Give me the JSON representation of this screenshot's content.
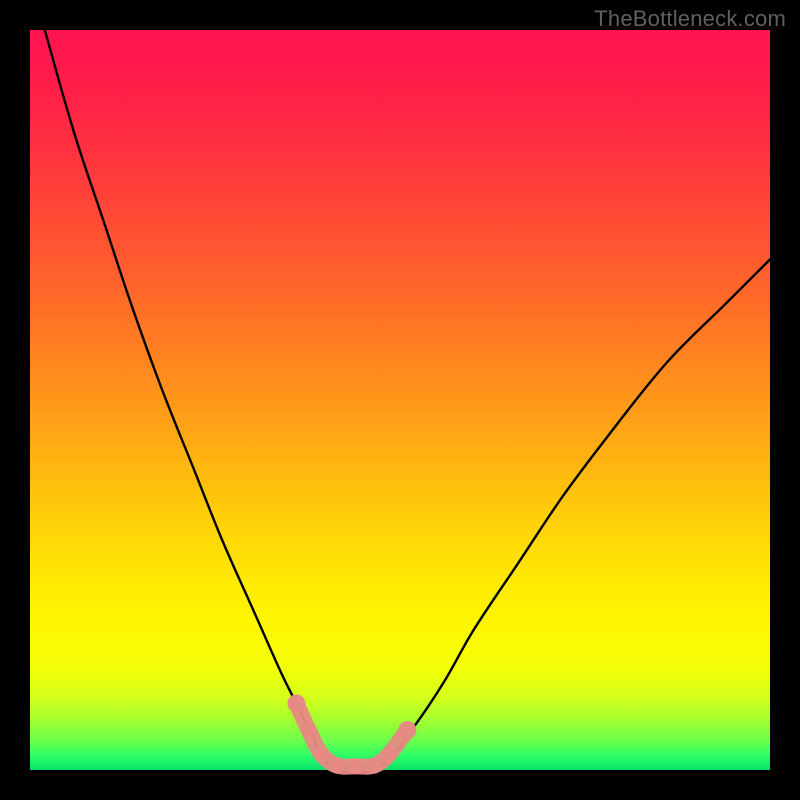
{
  "watermark": "TheBottleneck.com",
  "colors": {
    "background": "#000000",
    "curve": "#000000",
    "marker": "#e78a84",
    "gradient_top": "#ff1450",
    "gradient_bottom": "#08e26a"
  },
  "chart_data": {
    "type": "line",
    "title": "",
    "xlabel": "",
    "ylabel": "",
    "xlim": [
      0,
      100
    ],
    "ylim": [
      0,
      100
    ],
    "grid": false,
    "series": [
      {
        "name": "left-curve",
        "x": [
          2,
          6,
          10,
          14,
          18,
          22,
          26,
          30,
          34,
          36,
          38,
          40
        ],
        "y": [
          100,
          86,
          74,
          62,
          51,
          41,
          31,
          22,
          13,
          9,
          5,
          1
        ]
      },
      {
        "name": "right-curve",
        "x": [
          48,
          52,
          56,
          60,
          66,
          72,
          78,
          86,
          94,
          100
        ],
        "y": [
          1,
          6,
          12,
          19,
          28,
          37,
          45,
          55,
          63,
          69
        ]
      },
      {
        "name": "floor",
        "x": [
          40,
          44,
          48
        ],
        "y": [
          0.5,
          0.5,
          0.5
        ]
      }
    ],
    "markers": {
      "name": "highlighted-points",
      "color": "#e78a84",
      "points": [
        {
          "x": 36,
          "y": 9
        },
        {
          "x": 37.7,
          "y": 5.3
        },
        {
          "x": 39.4,
          "y": 2.1
        },
        {
          "x": 41.5,
          "y": 0.6
        },
        {
          "x": 44,
          "y": 0.5
        },
        {
          "x": 46.5,
          "y": 0.6
        },
        {
          "x": 48.5,
          "y": 2.1
        },
        {
          "x": 51,
          "y": 5.4
        }
      ]
    }
  }
}
